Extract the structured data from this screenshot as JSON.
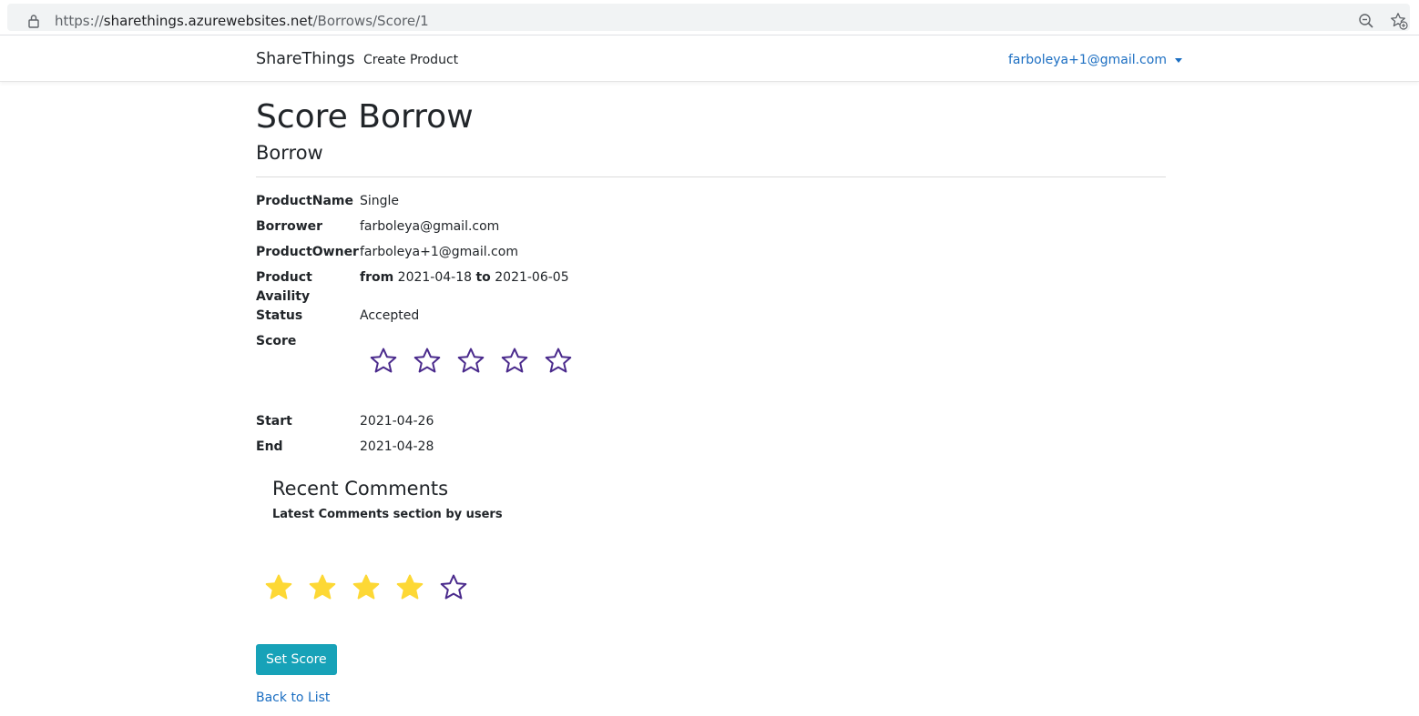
{
  "browser": {
    "url_prefix": "https://",
    "url_host": "sharethings.azurewebsites.net",
    "url_path": "/Borrows/Score/1"
  },
  "navbar": {
    "brand": "ShareThings",
    "create_product": "Create Product",
    "user_email": "farboleya+1@gmail.com"
  },
  "page": {
    "title": "Score Borrow",
    "subtitle": "Borrow"
  },
  "details": {
    "product_name_label": "ProductName",
    "product_name_value": "Single",
    "borrower_label": "Borrower",
    "borrower_value": "farboleya@gmail.com",
    "owner_label": "ProductOwner",
    "owner_value": "farboleya+1@gmail.com",
    "availability_label_1": "Product",
    "availability_label_2": "Availity",
    "availability_from_word": "from",
    "availability_from": "2021-04-18",
    "availability_to_word": "to",
    "availability_to": "2021-06-05",
    "status_label": "Status",
    "status_value": "Accepted",
    "score_label": "Score",
    "score_rating": 0,
    "score_max": 5,
    "start_label": "Start",
    "start_value": "2021-04-26",
    "end_label": "End",
    "end_value": "2021-04-28"
  },
  "comments": {
    "title": "Recent Comments",
    "subtitle": "Latest Comments section by users"
  },
  "rating_input": {
    "value": 4,
    "max": 5
  },
  "actions": {
    "set_score": "Set Score",
    "back_to_list": "Back to List"
  },
  "colors": {
    "link": "#1b6ec2",
    "button": "#17a2b8",
    "star_filled": "#fdd835",
    "star_outline": "#4a2a8c"
  },
  "icons": {
    "lock": "lock-icon",
    "zoom": "zoom-out-icon",
    "favorites": "add-favorite-icon",
    "star": "star-icon"
  }
}
